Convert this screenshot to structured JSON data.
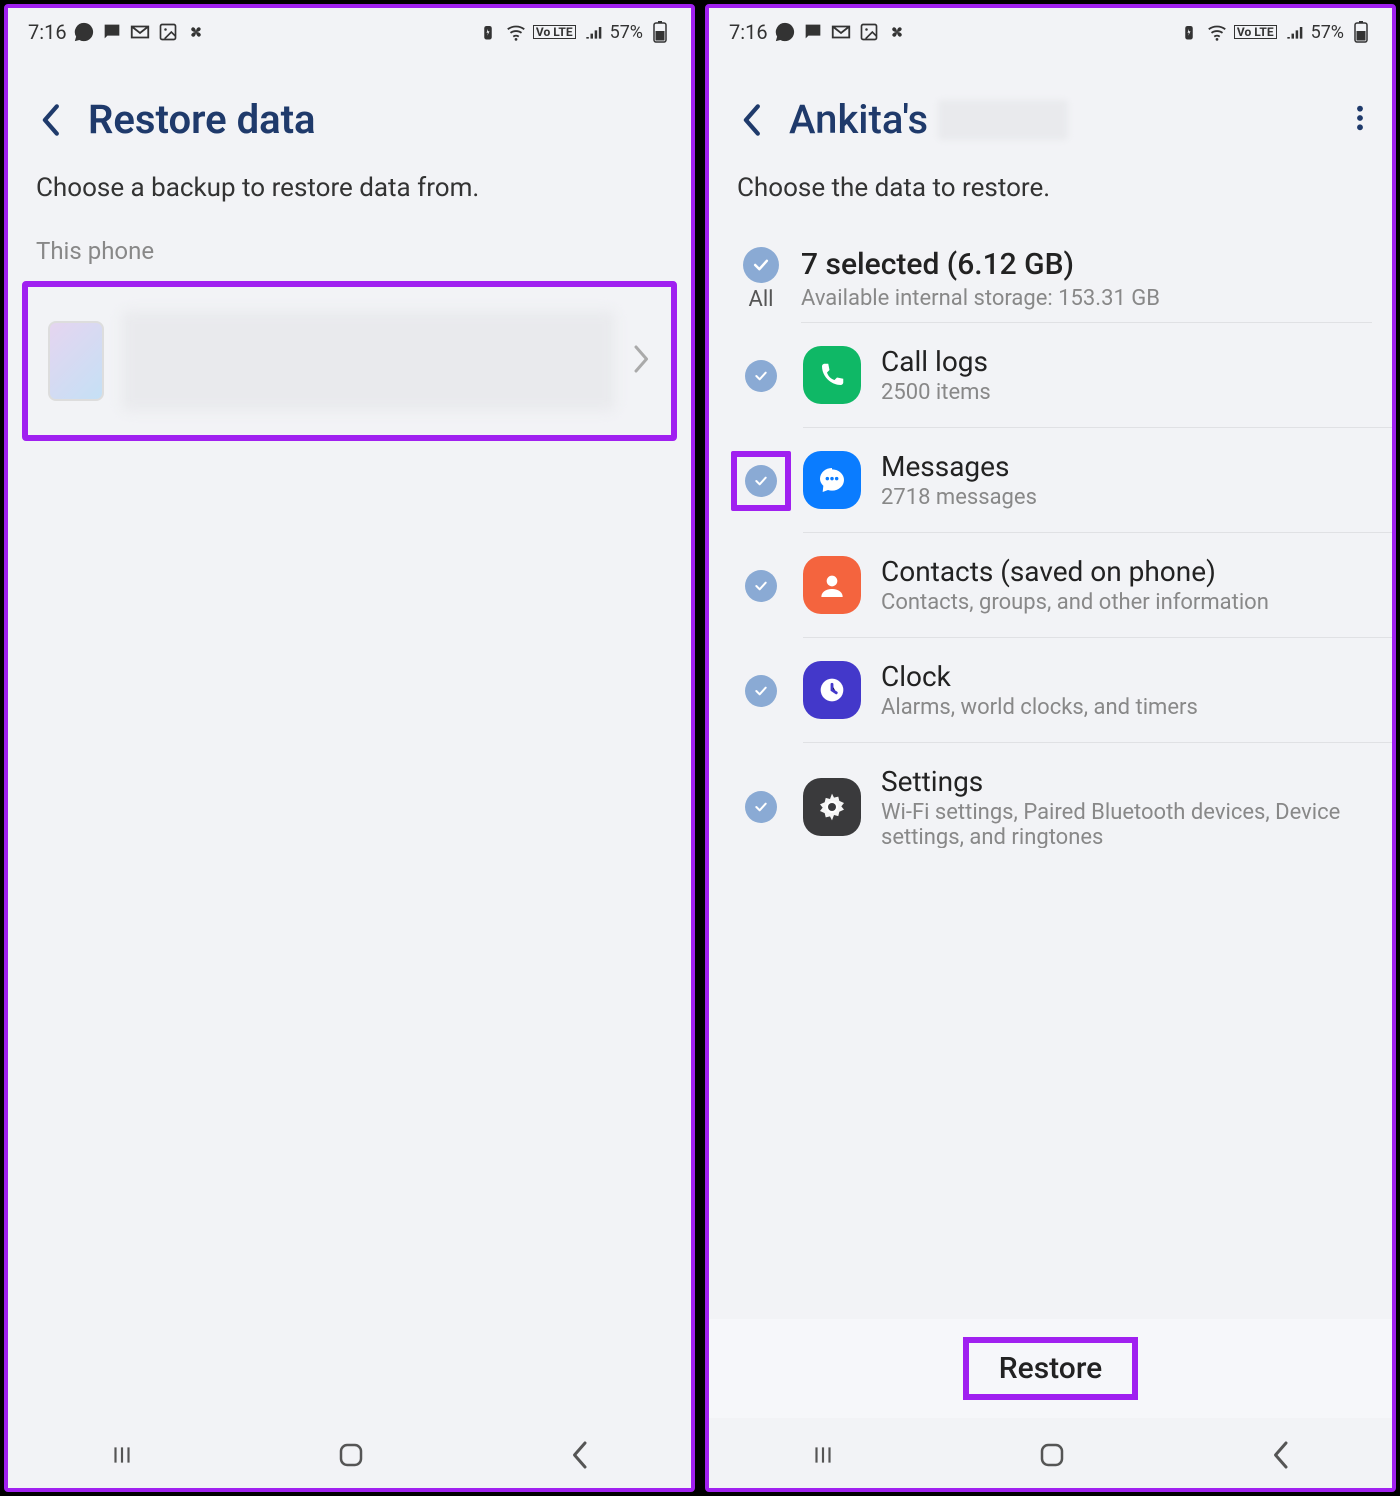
{
  "status": {
    "time": "7:16",
    "battery": "57%",
    "volte": "Vo LTE"
  },
  "left": {
    "title": "Restore data",
    "subtitle": "Choose a backup to restore data from.",
    "section_label": "This phone"
  },
  "right": {
    "title_prefix": "Ankita's",
    "subtitle": "Choose the data to restore.",
    "all_label": "All",
    "summary_title": "7 selected (6.12 GB)",
    "summary_sub": "Available internal storage: 153.31 GB",
    "items": [
      {
        "title": "Call logs",
        "sub": "2500 items"
      },
      {
        "title": "Messages",
        "sub": "2718 messages"
      },
      {
        "title": "Contacts (saved on phone)",
        "sub": "Contacts, groups, and other information"
      },
      {
        "title": "Clock",
        "sub": "Alarms, world clocks, and timers"
      },
      {
        "title": "Settings",
        "sub": "Wi-Fi settings, Paired Bluetooth devices, Device settings, and ringtones"
      }
    ],
    "restore_label": "Restore"
  }
}
